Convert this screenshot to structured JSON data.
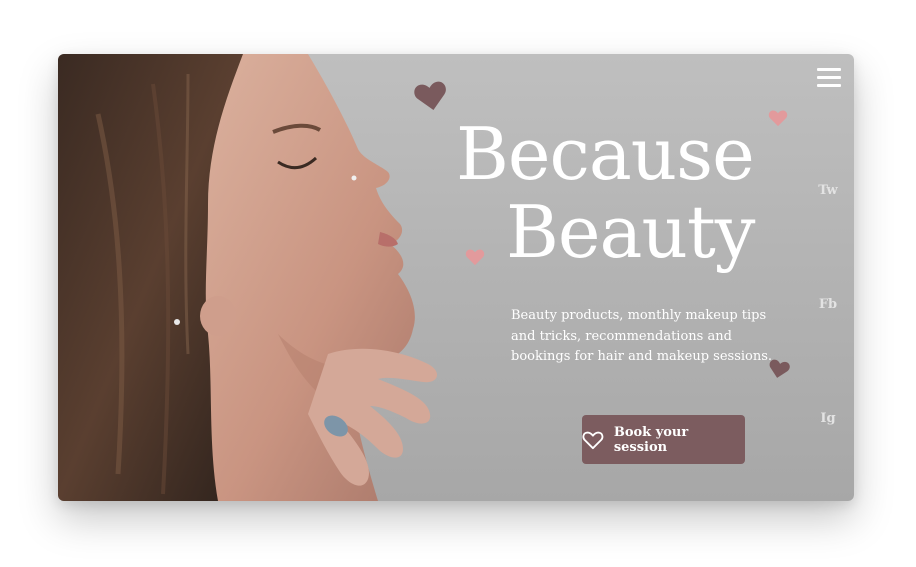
{
  "hero": {
    "title_line1": "Because",
    "title_line2": "Beauty",
    "description_lines": [
      "Beauty products, monthly makeup tips",
      "and tricks, recommendations and",
      "bookings for hair and makeup sessions."
    ],
    "cta_label": "Book your session",
    "cta_icon": "heart-outline-icon"
  },
  "menu": {
    "icon": "hamburger-menu-icon"
  },
  "social": {
    "twitter": "Tw",
    "facebook": "Fb",
    "instagram": "Ig"
  },
  "colors": {
    "background": "#b5b5b5",
    "accent": "#7c5c5f",
    "heart_dark": "#7a5a5d",
    "heart_pink": "#e29a9c",
    "text": "#ffffff"
  }
}
